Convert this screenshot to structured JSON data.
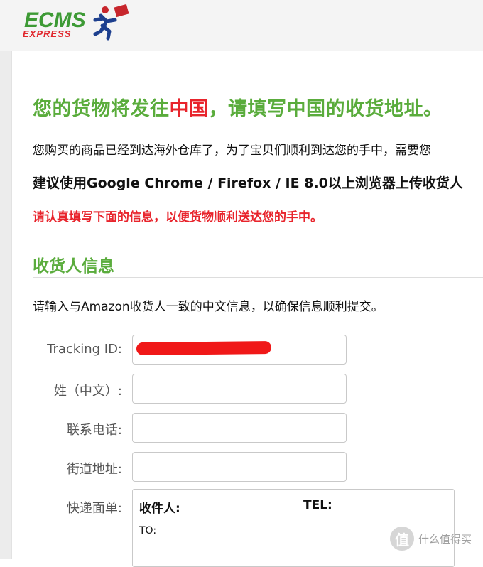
{
  "header": {
    "logo_text": "ECMS",
    "logo_subtext": "EXPRESS"
  },
  "page": {
    "title_part1": "您的货物将发往",
    "title_part2": "中国",
    "title_part3": "，请填写中国的收货地址。",
    "intro": "您购买的商品已经到达海外仓库了，为了宝贝们顺利到达您的手中，需要您",
    "browser_note": "建议使用Google Chrome / Firefox / IE 8.0以上浏览器上传收货人",
    "warning": "请认真填写下面的信息，以便货物顺利送达您的手中。"
  },
  "section": {
    "title": "收货人信息",
    "description": "请输入与Amazon收货人一致的中文信息，以确保信息顺利提交。"
  },
  "form": {
    "tracking_label": "Tracking ID:",
    "tracking_value": "",
    "surname_label": "姓（中文）:",
    "surname_value": "",
    "phone_label": "联系电话:",
    "phone_value": "",
    "address_label": "街道地址:",
    "address_value": "",
    "waybill_label": "快递面单:",
    "waybill": {
      "recipient": "收件人:",
      "tel": "TEL:",
      "to": "TO:"
    }
  },
  "watermark": {
    "badge": "值",
    "text": "什么值得买"
  }
}
